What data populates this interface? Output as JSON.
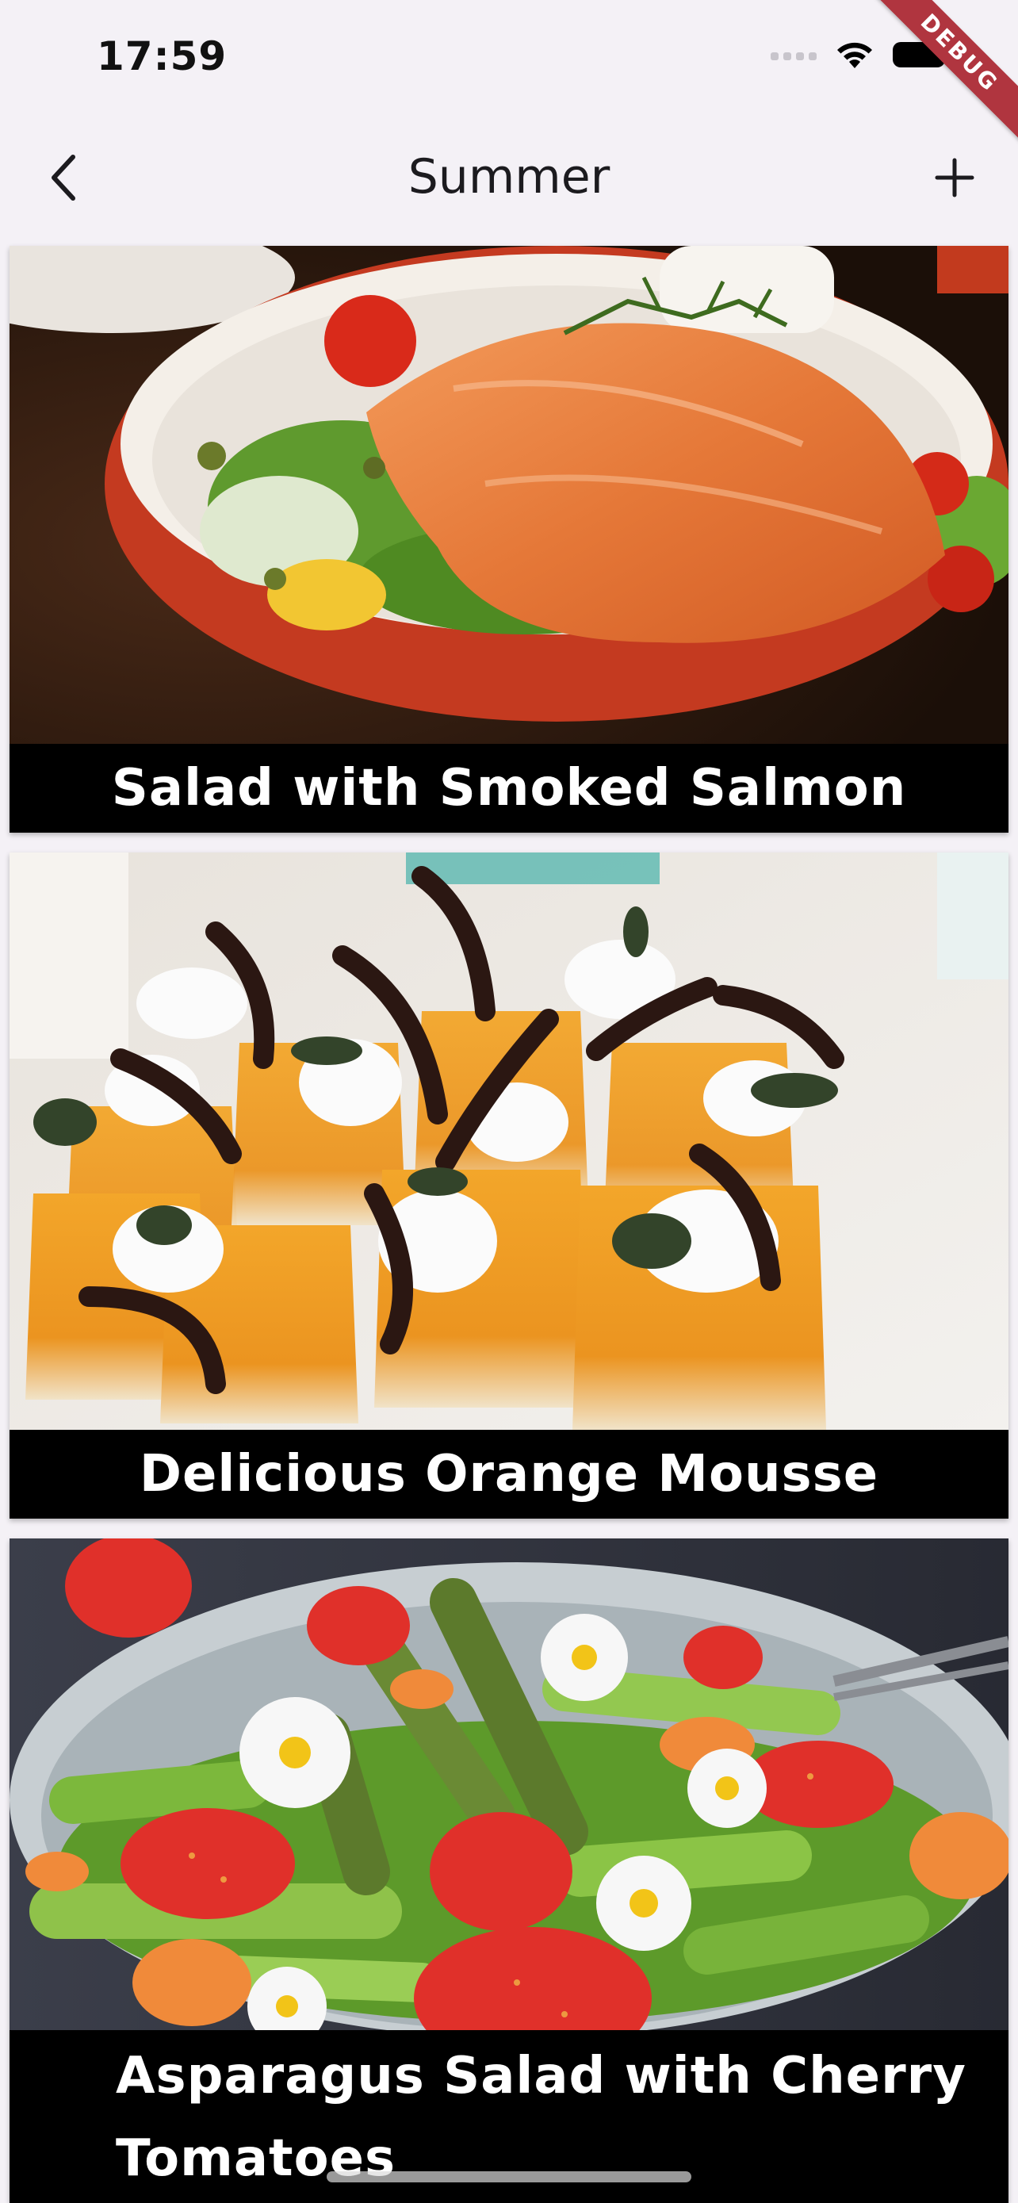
{
  "status_bar": {
    "time": "17:59",
    "wifi_icon": "wifi-icon",
    "battery_icon": "battery-icon",
    "signal_icon": "signal-icon"
  },
  "debug_banner": "DEBUG",
  "app_bar": {
    "title": "Summer",
    "back_icon": "chevron-left-icon",
    "add_icon": "plus-icon"
  },
  "meals": [
    {
      "title": "Salad with Smoked Salmon"
    },
    {
      "title": "Delicious Orange Mousse"
    },
    {
      "title": "Asparagus Salad with Cherry Tomatoes"
    }
  ]
}
